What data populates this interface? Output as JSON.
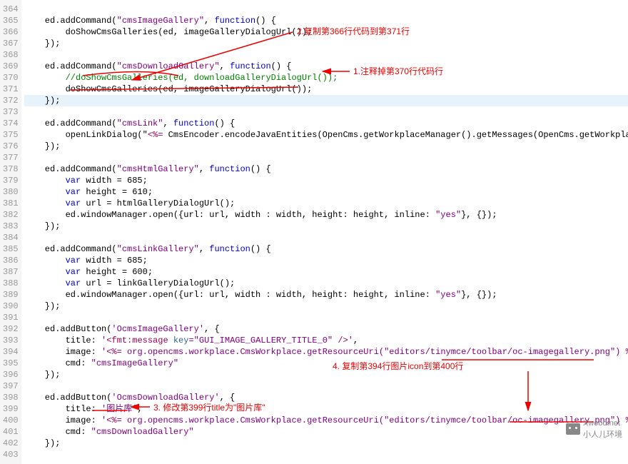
{
  "lines": [
    {
      "n": 364,
      "h": ""
    },
    {
      "n": 365,
      "h": "    ed.addCommand(\"cmsImageGallery\", function() {"
    },
    {
      "n": 366,
      "h": "        doShowCmsGalleries(ed, imageGalleryDialogUrl());"
    },
    {
      "n": 367,
      "h": "    });"
    },
    {
      "n": 368,
      "h": ""
    },
    {
      "n": 369,
      "h": "    ed.addCommand(\"cmsDownloadGallery\", function() {"
    },
    {
      "n": 370,
      "h": "        //doShowCmsGalleries(ed, downloadGalleryDialogUrl());"
    },
    {
      "n": 371,
      "h": "        doShowCmsGalleries(ed, imageGalleryDialogUrl());"
    },
    {
      "n": 372,
      "h": "    });",
      "hl": true
    },
    {
      "n": 373,
      "h": ""
    },
    {
      "n": 374,
      "h": "    ed.addCommand(\"cmsLink\", function() {"
    },
    {
      "n": 375,
      "h": "        openLinkDialog(\"<%= CmsEncoder.encodeJavaEntities(OpenCms.getWorkplaceManager().getMessages(OpenCms.getWorkplaceMana"
    },
    {
      "n": 376,
      "h": "    });"
    },
    {
      "n": 377,
      "h": ""
    },
    {
      "n": 378,
      "h": "    ed.addCommand(\"cmsHtmlGallery\", function() {"
    },
    {
      "n": 379,
      "h": "        var width = 685;"
    },
    {
      "n": 380,
      "h": "        var height = 610;"
    },
    {
      "n": 381,
      "h": "        var url = htmlGalleryDialogUrl();"
    },
    {
      "n": 382,
      "h": "        ed.windowManager.open({url: url, width : width, height: height, inline: \"yes\"}, {});"
    },
    {
      "n": 383,
      "h": "    });"
    },
    {
      "n": 384,
      "h": ""
    },
    {
      "n": 385,
      "h": "    ed.addCommand(\"cmsLinkGallery\", function() {"
    },
    {
      "n": 386,
      "h": "        var width = 685;"
    },
    {
      "n": 387,
      "h": "        var height = 600;"
    },
    {
      "n": 388,
      "h": "        var url = linkGalleryDialogUrl();"
    },
    {
      "n": 389,
      "h": "        ed.windowManager.open({url: url, width : width, height: height, inline: \"yes\"}, {});"
    },
    {
      "n": 390,
      "h": "    });"
    },
    {
      "n": 391,
      "h": ""
    },
    {
      "n": 392,
      "h": "    ed.addButton('OcmsImageGallery', {"
    },
    {
      "n": 393,
      "h": "        title: '<fmt:message key=\"GUI_IMAGE_GALLERY_TITLE_0\" />',"
    },
    {
      "n": 394,
      "h": "        image: '<%= org.opencms.workplace.CmsWorkplace.getResourceUri(\"editors/tinymce/toolbar/oc-imagegallery.png\") %>',"
    },
    {
      "n": 395,
      "h": "        cmd: \"cmsImageGallery\""
    },
    {
      "n": 396,
      "h": "    });"
    },
    {
      "n": 397,
      "h": ""
    },
    {
      "n": 398,
      "h": "    ed.addButton('OcmsDownloadGallery', {"
    },
    {
      "n": 399,
      "h": "        title: '图片库',"
    },
    {
      "n": 400,
      "h": "        image: '<%= org.opencms.workplace.CmsWorkplace.getResourceUri(\"editors/tinymce/toolbar/oc-imagegallery.png\") %>',"
    },
    {
      "n": 401,
      "h": "        cmd: \"cmsDownloadGallery\""
    },
    {
      "n": 402,
      "h": "    });"
    },
    {
      "n": 403,
      "h": ""
    }
  ],
  "annotations": {
    "a1": "1.注释掉第370行代码行",
    "a2": "2.复制第366行代码到第371行",
    "a3": "3. 修改第399行title为\"图片库\"",
    "a4": "4. 复制第394行图片icon到第400行"
  },
  "watermark": {
    "top": "Xwood.net",
    "bottom": "小人儿环境"
  }
}
